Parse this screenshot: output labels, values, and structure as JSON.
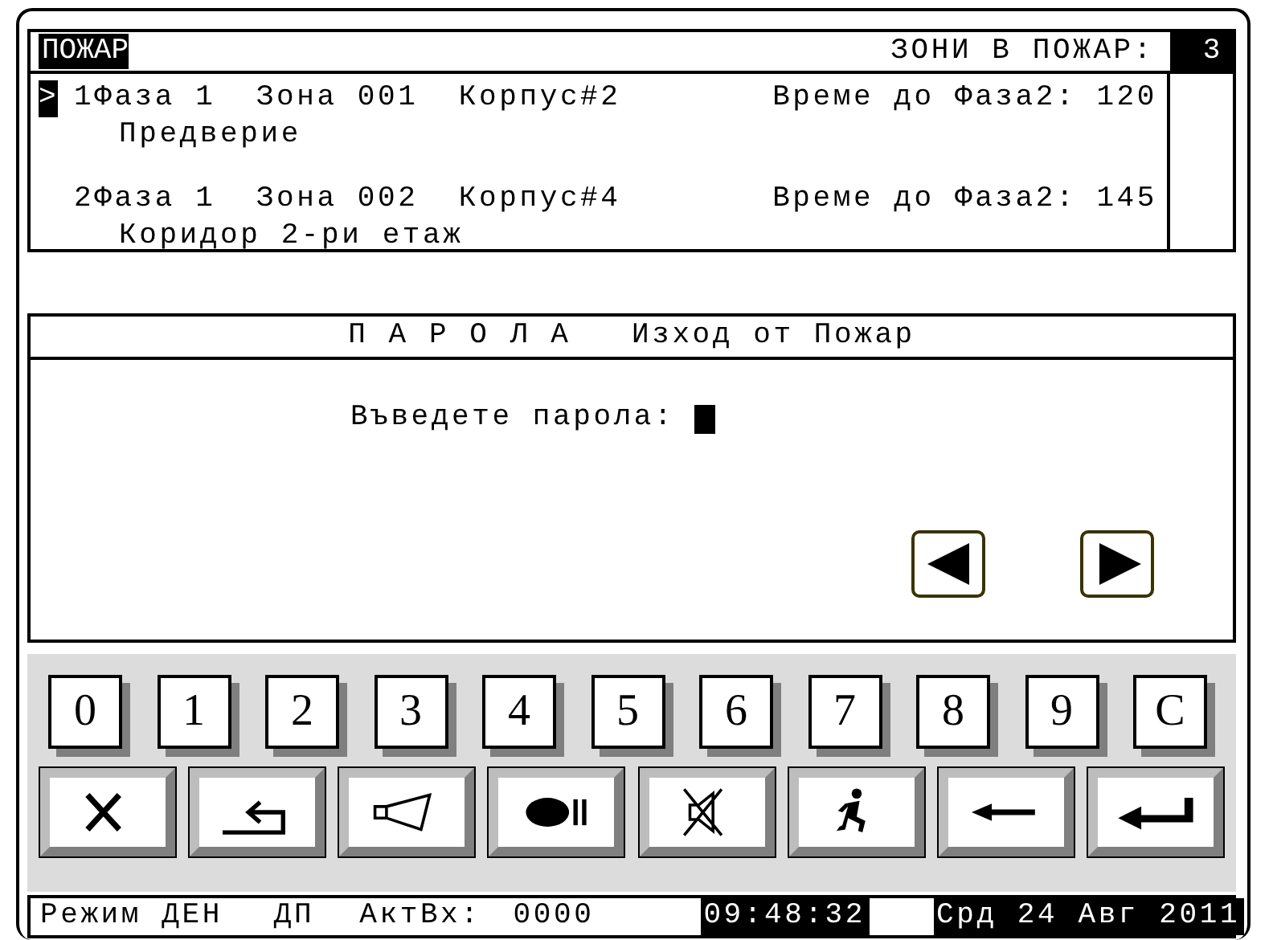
{
  "fire_panel": {
    "title": "ПОЖАР",
    "zones_label": "ЗОНИ В ПОЖАР:",
    "zones_count": "3",
    "cursor": ">",
    "rows": [
      {
        "selected": true,
        "line": "1Фаза 1  Зона 001  Корпус#2",
        "timer": "Време до Фаза2: 120",
        "location": "Предверие"
      },
      {
        "selected": false,
        "line": "2Фаза 1  Зона 002  Корпус#4",
        "timer": "Време до Фаза2: 145",
        "location": "Коридор 2-ри етаж"
      }
    ]
  },
  "password_panel": {
    "title": "П А Р О Л А   Изход от Пожар",
    "prompt": "Въведете парола:",
    "nav_buttons": [
      {
        "kind": "left"
      },
      {
        "kind": "right"
      }
    ]
  },
  "keypad": {
    "keys": [
      "0",
      "1",
      "2",
      "3",
      "4",
      "5",
      "6",
      "7",
      "8",
      "9",
      "C"
    ],
    "function_keys": [
      {
        "kind": "cancel"
      },
      {
        "kind": "return"
      },
      {
        "kind": "horn"
      },
      {
        "kind": "bell-pause"
      },
      {
        "kind": "mute"
      },
      {
        "kind": "evacuate"
      },
      {
        "kind": "backspace"
      },
      {
        "kind": "enter"
      }
    ]
  },
  "status_bar": [
    {
      "text": "Режим ДЕН",
      "highlighted": false
    },
    {
      "text": "ДП",
      "highlighted": false
    },
    {
      "text": "АктВх:",
      "highlighted": false
    },
    {
      "text": "0000",
      "highlighted": false
    },
    {
      "text": "09:48:32",
      "highlighted": true
    },
    {
      "text": "Срд 24 Авг 2011",
      "highlighted": true
    }
  ]
}
